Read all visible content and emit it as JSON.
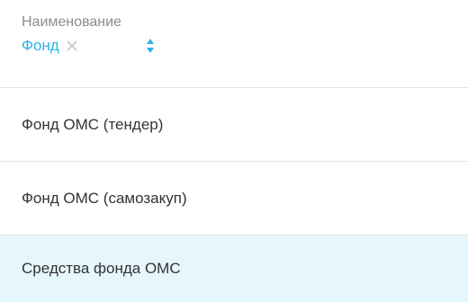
{
  "column": {
    "title": "Наименование",
    "filter_value": "Фонд"
  },
  "icons": {
    "clear": "close-icon",
    "sort": "sort-icon"
  },
  "colors": {
    "accent": "#2bb3e6",
    "selected_row_bg": "#e6f6fd",
    "header_text": "#8c8c8c"
  },
  "rows": [
    {
      "label": "Фонд ОМС (тендер)"
    },
    {
      "label": "Фонд ОМС (самозакуп)"
    },
    {
      "label": "Средства фонда ОМС",
      "selected": true
    }
  ]
}
